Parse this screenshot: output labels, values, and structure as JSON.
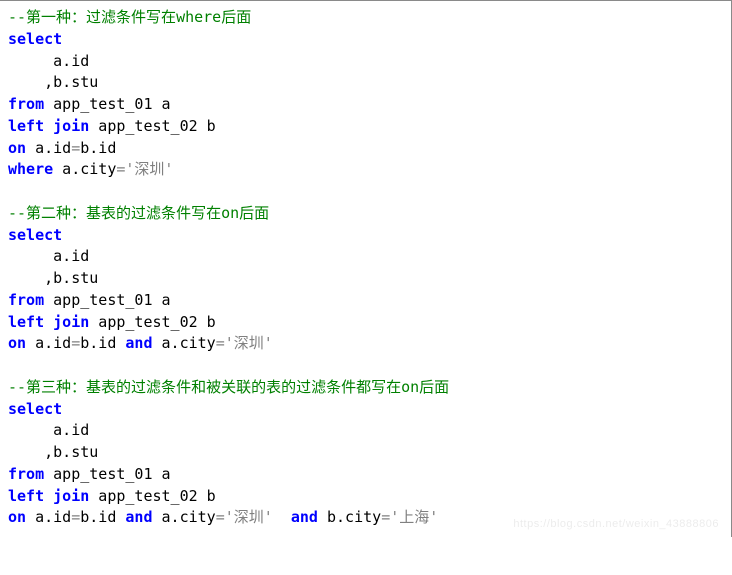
{
  "code": {
    "c1": "--第一种：过滤条件写在where后面",
    "sel": "select",
    "col_a": "a.id",
    "col_b": ",b.stu",
    "from": "from",
    "t1": " app_test_01 a",
    "lj": "left join",
    "t2": " app_test_02 b",
    "on": "on",
    "on_cond1": " a.id",
    "eq": "=",
    "on_cond2": "b.id",
    "where": "where",
    "w1a": " a.city",
    "w1b": "'深圳'",
    "c2": "--第二种：基表的过滤条件写在on后面",
    "and": "and",
    "and_a": " a.city",
    "and_b": "'深圳'",
    "c3": "--第三种：基表的过滤条件和被关联的表的过滤条件都写在on后面",
    "b_city": " b.city",
    "b_val": "'上海'"
  },
  "watermark": "https://blog.csdn.net/weixin_43888806"
}
